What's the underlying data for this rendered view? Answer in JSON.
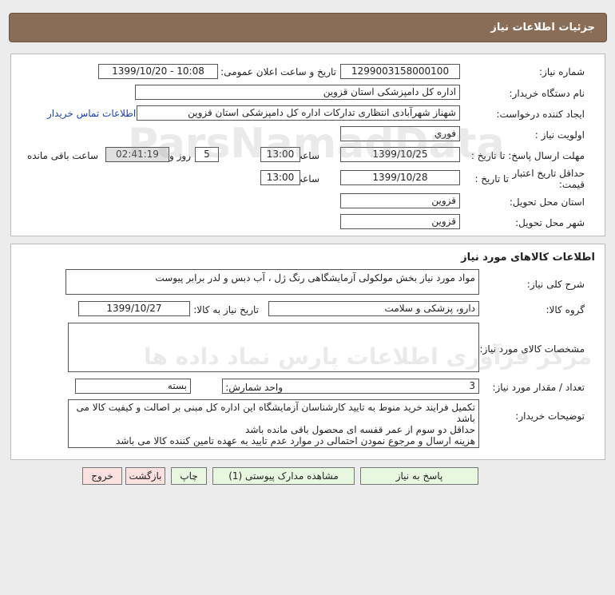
{
  "header": {
    "title": "جزئیات اطلاعات نیاز"
  },
  "info": {
    "need_number_label": "شماره نیاز:",
    "need_number": "1299003158000100",
    "announce_label": "تاریخ و ساعت اعلان عمومی:",
    "announce_value": "1399/10/20 - 10:08",
    "buyer_org_label": "نام دستگاه خریدار:",
    "buyer_org": "اداره کل دامپزشکی استان قزوین",
    "creator_label": "ایجاد کننده درخواست:",
    "creator": "شهناز شهرآبادی انتظاری تدارکات اداره کل دامپزشکی استان قزوین",
    "contact_link": "اطلاعات تماس خریدار",
    "priority_label": "اولویت نیاز :",
    "priority": "فوري",
    "reply_deadline_label": "مهلت ارسال پاسخ: تا تاریخ :",
    "reply_date": "1399/10/25",
    "time_label": "ساعت",
    "reply_time": "13:00",
    "days_value": "5",
    "days_label": "روز و",
    "remaining_time": "02:41:19",
    "remaining_label": "ساعت باقی مانده",
    "price_validity_label_1": "حداقل تاریخ اعتبار",
    "price_validity_label_2": "قیمت:",
    "until_date_label": "تا تاریخ :",
    "validity_date": "1399/10/28",
    "validity_time": "13:00",
    "province_label": "استان محل تحویل:",
    "province": "قزوین",
    "city_label": "شهر محل تحویل:",
    "city": "قزوین"
  },
  "goods": {
    "section_title": "اطلاعات کالاهای مورد نیاز",
    "description_label": "شرح کلی نیاز:",
    "description": "مواد مورد نیاز بخش مولکولی آزمایشگاهی رنگ ژل ، آب دبس و لدر برابر پیوست",
    "group_label": "گروه کالا:",
    "group": "دارو، پزشکی و سلامت",
    "need_date_label": "تاریخ نیاز به کالا:",
    "need_date": "1399/10/27",
    "specs_label": "مشخصات کالای مورد نیاز:",
    "specs": "",
    "qty_label": "تعداد / مقدار مورد نیاز:",
    "qty": "3",
    "unit_label": "واحد شمارش:",
    "unit": "بسته",
    "notes_label": "توضیحات خریدار:",
    "notes": [
      "تکمیل فرایند خرید منوط به تایید کارشناسان آزمایشگاه این اداره کل مبنی بر اصالت و کیفیت کالا می باشد",
      "حداقل دو سوم از عمر قفسه ای محصول باقی مانده باشد",
      "هزینه ارسال و مرجوع نمودن احتمالی در موارد عدم تایید به عهده تامین کننده کالا می باشد"
    ]
  },
  "buttons": {
    "reply": "پاسخ به نیاز",
    "attachments": "مشاهده مدارک پیوستی (1)",
    "print": "چاپ",
    "back": "بازگشت",
    "exit": "خروج"
  },
  "watermark": {
    "line1": "ParsNamadData",
    "line2": "مرکز فرآوری اطلاعات پارس نماد داده ها"
  }
}
